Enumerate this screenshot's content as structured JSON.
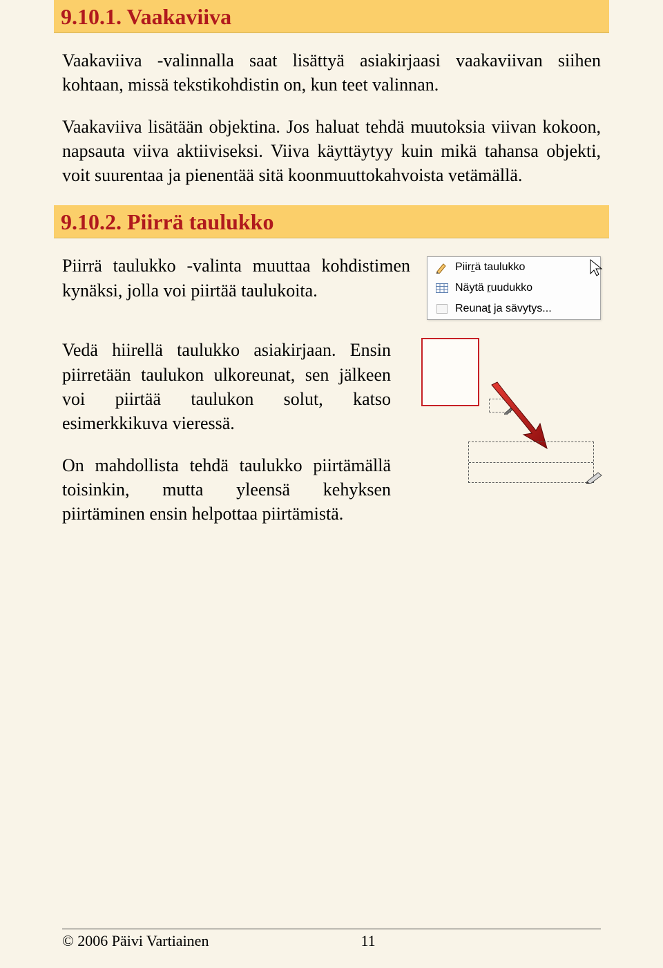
{
  "section1": {
    "number": "9.10.1.",
    "title": "Vaakaviiva",
    "para1": "Vaakaviiva -valinnalla saat lisättyä asiakirjaasi vaakaviivan siihen kohtaan, missä tekstikohdistin on, kun teet valinnan.",
    "para2": "Vaakaviiva lisätään objektina. Jos haluat tehdä muutoksia viivan kokoon, napsauta viiva aktiiviseksi. Viiva käyttäytyy kuin mikä tahansa objekti, voit suurentaa ja pienentää sitä koonmuuttokahvoista vetämällä."
  },
  "section2": {
    "number": "9.10.2.",
    "title": "Piirrä taulukko",
    "para1": "Piirrä taulukko -valinta muuttaa kohdistimen kynäksi, jolla voi piirtää taulukoita.",
    "para2": "Vedä hiirellä taulukko asiakirjaan. Ensin piirretään taulukon ulkoreunat, sen jälkeen voi piirtää taulukon solut, katso esimerkkikuva vieressä.",
    "para3": "On mahdollista tehdä taulukko piirtämällä toisinkin, mutta yleensä kehyksen piirtäminen ensin helpottaa piirtämistä."
  },
  "menu": {
    "item1_pre": "Piir",
    "item1_u": "r",
    "item1_post": "ä taulukko",
    "item2_pre": "Näytä ",
    "item2_u": "r",
    "item2_post": "uudukko",
    "item3_pre": "Reuna",
    "item3_u": "t",
    "item3_post": " ja sävytys..."
  },
  "footer": {
    "copyright": "© 2006 Päivi Vartiainen",
    "page": "11"
  }
}
